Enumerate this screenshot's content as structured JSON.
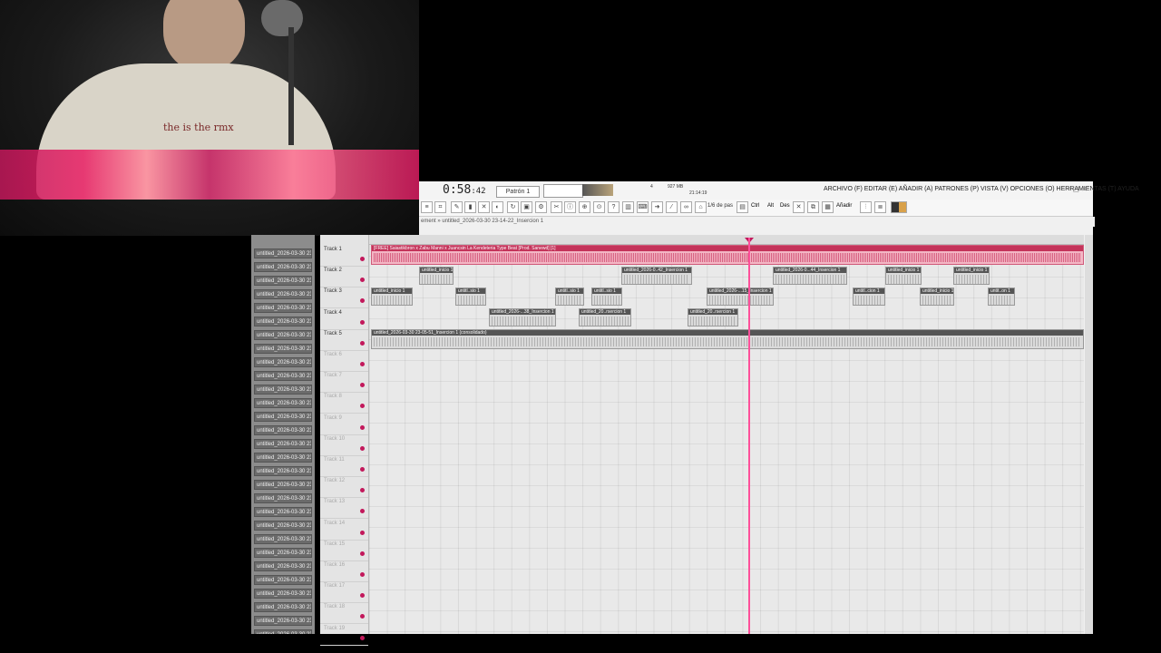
{
  "webcam": {
    "shirt_text": "the is the rmx"
  },
  "toolbar": {
    "time_main": "0:58",
    "time_sub": "42",
    "pattern": "Patrón 1",
    "menu": "ARCHIVO (F) EDITAR (E) AÑADIR (A) PATRONES (P) VISTA (V) OPCIONES (O) HERRAMIENTAS (T) AYUDA",
    "cpu": "4",
    "mem": "927 MB",
    "clock": "21:14:19",
    "tool_tip": "1/6 de pas",
    "cut": "Ctrl",
    "alt": "Alt",
    "des": "Des",
    "add": "Añadir"
  },
  "breadcrumb": "ement » untitled_2026-03-30 23-14-22_Insercion 1",
  "picker": [
    "untitled_2026-03-30 23-",
    "untitled_2026-03-30 23-",
    "untitled_2026-03-30 23-",
    "untitled_2026-03-30 23-",
    "untitled_2026-03-30 23-",
    "untitled_2026-03-30 23-",
    "untitled_2026-03-30 23-",
    "untitled_2026-03-30 23-",
    "untitled_2026-03-30 23-",
    "untitled_2026-03-30 23-",
    "untitled_2026-03-30 23-",
    "untitled_2026-03-30 23-",
    "untitled_2026-03-30 23-",
    "untitled_2026-03-30 23-",
    "untitled_2026-03-30 23-",
    "untitled_2026-03-30 23-",
    "untitled_2026-03-30 23-",
    "untitled_2026-03-30 23-",
    "untitled_2026-03-30 23-",
    "untitled_2026-03-30 23-",
    "untitled_2026-03-30 23-",
    "untitled_2026-03-30 23-",
    "untitled_2026-03-30 23-",
    "untitled_2026-03-30 23-",
    "untitled_2026-03-30 23-",
    "untitled_2026-03-30 23-",
    "untitled_2026-03-30 23-",
    "untitled_2026-03-30 23-",
    "untitled_2026-03-30 23-"
  ],
  "tracks": [
    "Track 1",
    "Track 2",
    "Track 3",
    "Track 4",
    "Track 5",
    "Track 6",
    "Track 7",
    "Track 8",
    "Track 9",
    "Track 10",
    "Track 11",
    "Track 12",
    "Track 13",
    "Track 14",
    "Track 15",
    "Track 16",
    "Track 17",
    "Track 18",
    "Track 19"
  ],
  "clips": {
    "beat": "[FREE] Saiastikbron x Zabu Manni x Juancsin La Kendeteria Type Beat [Prod. Sanewd] [1]",
    "t2a": "untitled_inicio 1",
    "t2b": "untitled_2026-0..42_Insercion 1",
    "t2c": "untitled_2026-0...44_Insercion 1",
    "t2d": "untitled_inicio 1",
    "t2e": "untitled_inicio 1",
    "t3a": "untitled_inicio 1",
    "t3b": "untitl..sio 1",
    "t3c": "untitl..sio 1",
    "t3d": "untitl..sio 1",
    "t3e": "untitled_2026-...15_Insercion 1",
    "t3f": "untitl..cion 1",
    "t3g": "untitled_inicio 1",
    "t3h": "untit..on 1",
    "t4a": "untitled_2026-...38_Insercion 1",
    "t4b": "untitled_20..rsercion 1",
    "t4c": "untitled_20..rsercion 1",
    "t5": "untitled_2026-03-30 23-05-51_Insercion 1 (consolidado)"
  }
}
